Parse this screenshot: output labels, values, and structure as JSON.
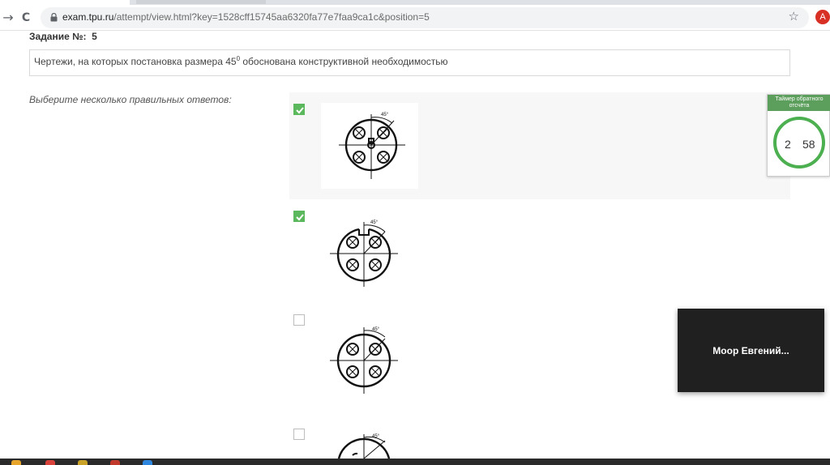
{
  "browser": {
    "url_host": "exam.tpu.ru",
    "url_path": "/attempt/view.html?key=1528cff15745aa6320fa77e7faa9ca1c&position=5",
    "profile_initial": "A",
    "back_glyph": "→",
    "reload_glyph": "C",
    "star_glyph": "☆"
  },
  "task": {
    "label": "Задание №:",
    "number": "5",
    "question_before": "Чертежи, на которых постановка размера 45",
    "question_sup": "0",
    "question_after": " обоснована конструктивной необходимостью",
    "instruction": "Выберите несколько правильных ответов:"
  },
  "options": [
    {
      "checked": true,
      "dimension_label": "45°"
    },
    {
      "checked": true,
      "dimension_label": "45°"
    },
    {
      "checked": false,
      "dimension_label": "45°"
    },
    {
      "checked": false,
      "dimension_label": "45°"
    }
  ],
  "timer": {
    "title_line1": "Таймер обратного",
    "title_line2": "отсчёта",
    "minutes": "2",
    "seconds": "58"
  },
  "video": {
    "participant_name": "Моор  Евгений..."
  },
  "colors": {
    "checkbox_checked": "#5cb85c",
    "timer_accent": "#4caf50",
    "profile": "#d93025"
  }
}
